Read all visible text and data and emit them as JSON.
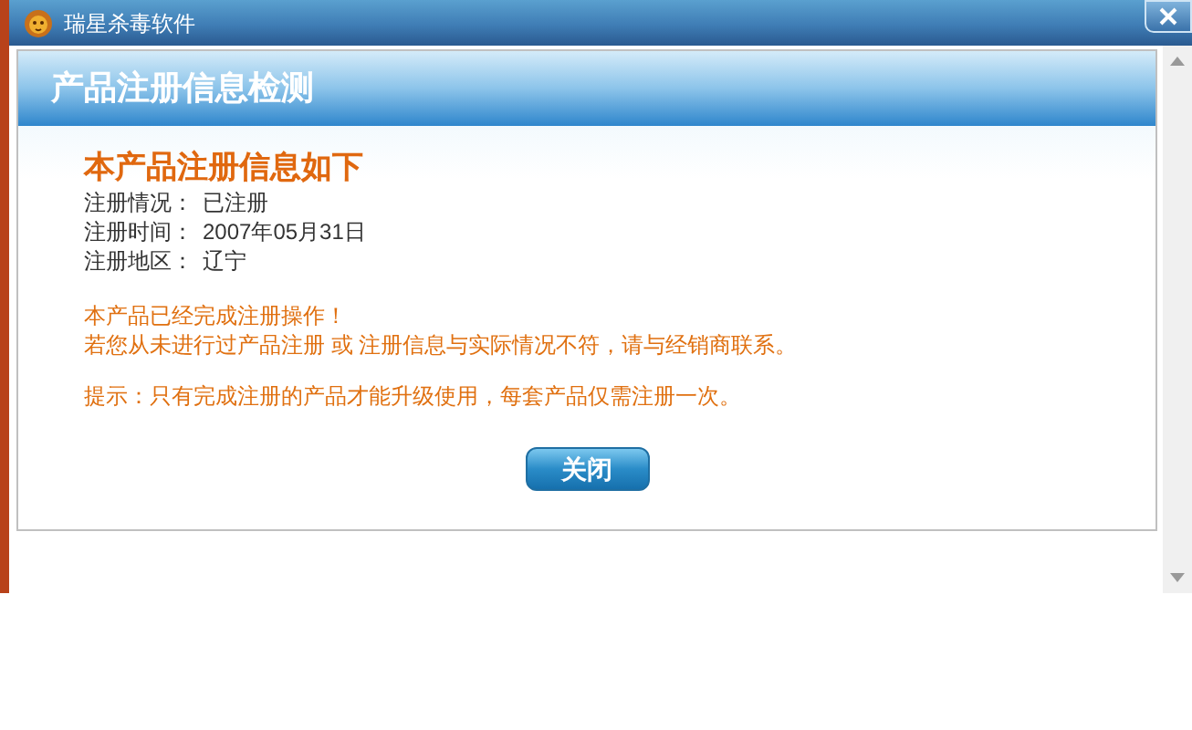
{
  "window": {
    "title": "瑞星杀毒软件"
  },
  "panel": {
    "title": "产品注册信息检测"
  },
  "heading": "本产品注册信息如下",
  "info": [
    {
      "label": "注册情况：",
      "value": "已注册"
    },
    {
      "label": "注册时间：",
      "value": "2007年05月31日"
    },
    {
      "label": "注册地区：",
      "value": "辽宁"
    }
  ],
  "notice": [
    "本产品已经完成注册操作！",
    "若您从未进行过产品注册 或 注册信息与实际情况不符，请与经销商联系。"
  ],
  "hint": "提示：只有完成注册的产品才能升级使用，每套产品仅需注册一次。",
  "buttons": [
    "关闭"
  ]
}
